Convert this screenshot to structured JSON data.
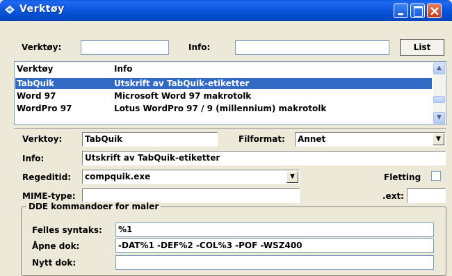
{
  "window": {
    "title": "Verktøy"
  },
  "toolbar": {
    "verktoy_label": "Verktøy:",
    "verktoy_value": "",
    "info_label": "Info:",
    "info_value": "",
    "list_button": "List"
  },
  "list": {
    "headers": [
      "Verktøy",
      "Info"
    ],
    "rows": [
      {
        "tool": "TabQuik",
        "info": "Utskrift av TabQuik-etiketter",
        "selected": true
      },
      {
        "tool": "Word 97",
        "info": "Microsoft Word 97 makrotolk",
        "selected": false
      },
      {
        "tool": "WordPro 97",
        "info": "Lotus WordPro 97 / 9 (millennium) makrotolk",
        "selected": false
      }
    ]
  },
  "detail": {
    "verktoy_label": "Verktoy:",
    "verktoy_value": "TabQuik",
    "filformat_label": "Filformat:",
    "filformat_value": "Annet",
    "info_label": "Info:",
    "info_value": "Utskrift av TabQuik-etiketter",
    "regeditid_label": "Regeditid:",
    "regeditid_value": "compquik.exe",
    "fletting_label": "Fletting",
    "mime_label": "MIME-type:",
    "mime_value": "",
    "ext_label": ".ext:",
    "ext_value": ""
  },
  "dde": {
    "title": "DDE kommandoer for maler",
    "felles_label": "Felles syntaks:",
    "felles_value": "%1",
    "apne_label": "Åpne dok:",
    "apne_value": "-DAT%1 -DEF%2 -COL%3 -POF -WSZ400",
    "nytt_label": "Nytt dok:",
    "nytt_value": ""
  }
}
